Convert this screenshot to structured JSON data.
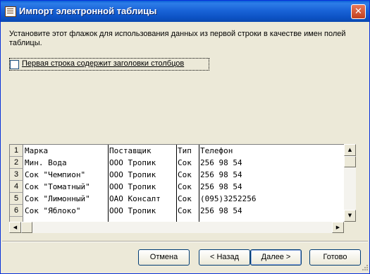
{
  "title": "Импорт электронной таблицы",
  "instruction": "Установите этот флажок для использования данных из первой строки в качестве имен полей таблицы.",
  "checkbox": {
    "label": "Первая строка содержит заголовки столбцов",
    "checked": false
  },
  "grid": {
    "rows": [
      {
        "num": "1",
        "cells": [
          "Марка",
          "Поставщик",
          "Тип",
          "Телефон"
        ]
      },
      {
        "num": "2",
        "cells": [
          "Мин. Вода",
          "ООО Тропик",
          "Сок",
          "256 98 54"
        ]
      },
      {
        "num": "3",
        "cells": [
          "Сок \"Чемпион\"",
          "ООО Тропик",
          "Сок",
          "256 98 54"
        ]
      },
      {
        "num": "4",
        "cells": [
          "Сок \"Томатный\"",
          "ООО Тропик",
          "Сок",
          "256 98 54"
        ]
      },
      {
        "num": "5",
        "cells": [
          "Сок \"Лимонный\"",
          "ОАО Консалт",
          "Сок",
          "(095)3252256"
        ]
      },
      {
        "num": "6",
        "cells": [
          "Сок \"Яблоко\"",
          "ООО Тропик",
          "Сок",
          "256 98 54"
        ]
      }
    ]
  },
  "buttons": {
    "cancel": "Отмена",
    "back": "< Назад",
    "next": "Далее >",
    "finish": "Готово"
  },
  "icons": {
    "title": "table-icon",
    "close": "close-icon"
  },
  "colors": {
    "titlebar": "#0a5fd6",
    "dialog": "#ece9d8",
    "close": "#c2401e"
  }
}
